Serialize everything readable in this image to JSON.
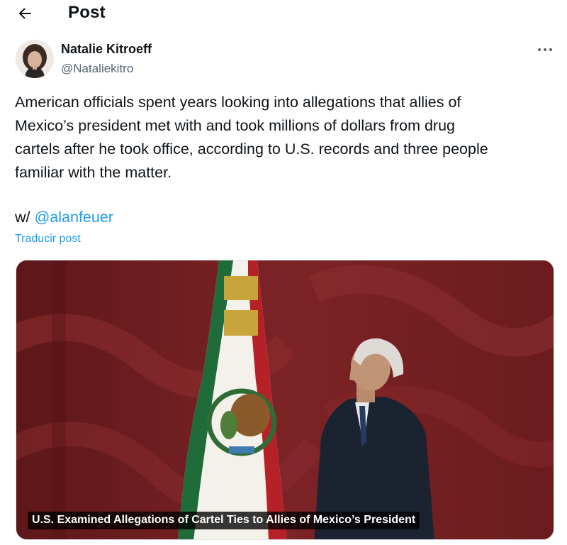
{
  "header": {
    "title": "Post",
    "back_icon": "arrow-left-icon"
  },
  "post": {
    "author": {
      "name": "Natalie Kitroeff",
      "handle": "@Nataliekitro"
    },
    "more_icon": "more-dots-icon",
    "text_lines": [
      "American officials spent years looking into allegations that allies of",
      "Mexico’s president met with and took millions of dollars from drug",
      "cartels after he took office, according to U.S. records and three people",
      "familiar with the matter."
    ],
    "mention_prefix": "w/",
    "mention": "@alanfeuer",
    "translate_label": "Traducir post",
    "card": {
      "caption": "U.S. Examined Allegations of Cartel Ties to Allies of Mexico’s President"
    }
  },
  "colors": {
    "link": "#1d9bf0",
    "secondary_text": "#536471",
    "primary_text": "#0f1419"
  }
}
